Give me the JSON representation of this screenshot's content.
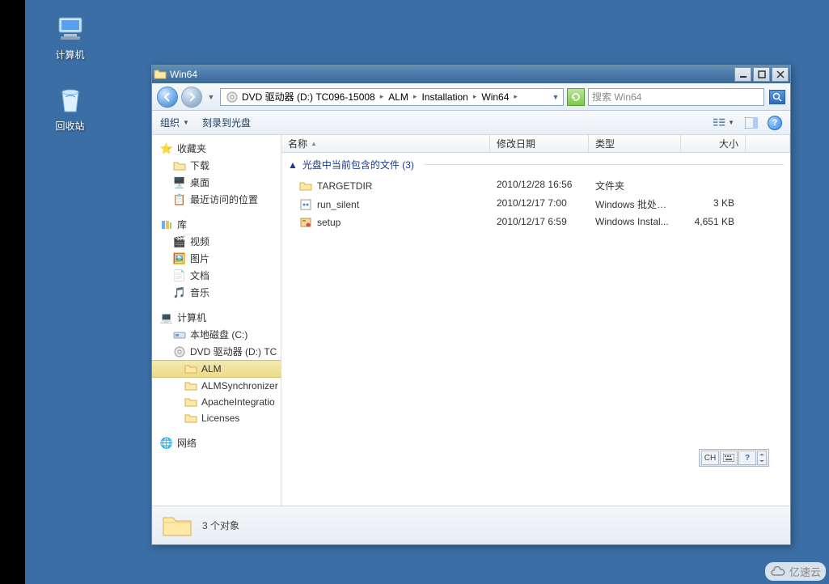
{
  "desktop": {
    "computer": "计算机",
    "recycle": "回收站"
  },
  "window": {
    "title": "Win64",
    "breadcrumb": {
      "drive": "DVD 驱动器 (D:) TC096-15008",
      "p1": "ALM",
      "p2": "Installation",
      "p3": "Win64"
    },
    "search_placeholder": "搜索 Win64"
  },
  "toolbar": {
    "organize": "组织",
    "burn": "刻录到光盘"
  },
  "columns": {
    "name": "名称",
    "modified": "修改日期",
    "type": "类型",
    "size": "大小"
  },
  "group": {
    "header": "光盘中当前包含的文件 (3)",
    "arrow": "▲"
  },
  "files": [
    {
      "name": "TARGETDIR",
      "date": "2010/12/28 16:56",
      "type": "文件夹",
      "size": "",
      "icon": "folder"
    },
    {
      "name": "run_silent",
      "date": "2010/12/17 7:00",
      "type": "Windows 批处理...",
      "size": "3 KB",
      "icon": "bat"
    },
    {
      "name": "setup",
      "date": "2010/12/17 6:59",
      "type": "Windows Instal...",
      "size": "4,651 KB",
      "icon": "msi"
    }
  ],
  "sidebar": {
    "favorites": "收藏夹",
    "downloads": "下载",
    "desktop": "桌面",
    "recent": "最近访问的位置",
    "libraries": "库",
    "videos": "视频",
    "pictures": "图片",
    "documents": "文档",
    "music": "音乐",
    "computer": "计算机",
    "local_disk": "本地磁盘 (C:)",
    "dvd": "DVD 驱动器 (D:) TC",
    "alm": "ALM",
    "alm_sync": "ALMSynchronizer",
    "apache": "ApacheIntegratio",
    "licenses": "Licenses",
    "network": "网络"
  },
  "ime": {
    "lang": "CH"
  },
  "status": {
    "count": "3 个对象"
  },
  "watermark": "亿速云"
}
